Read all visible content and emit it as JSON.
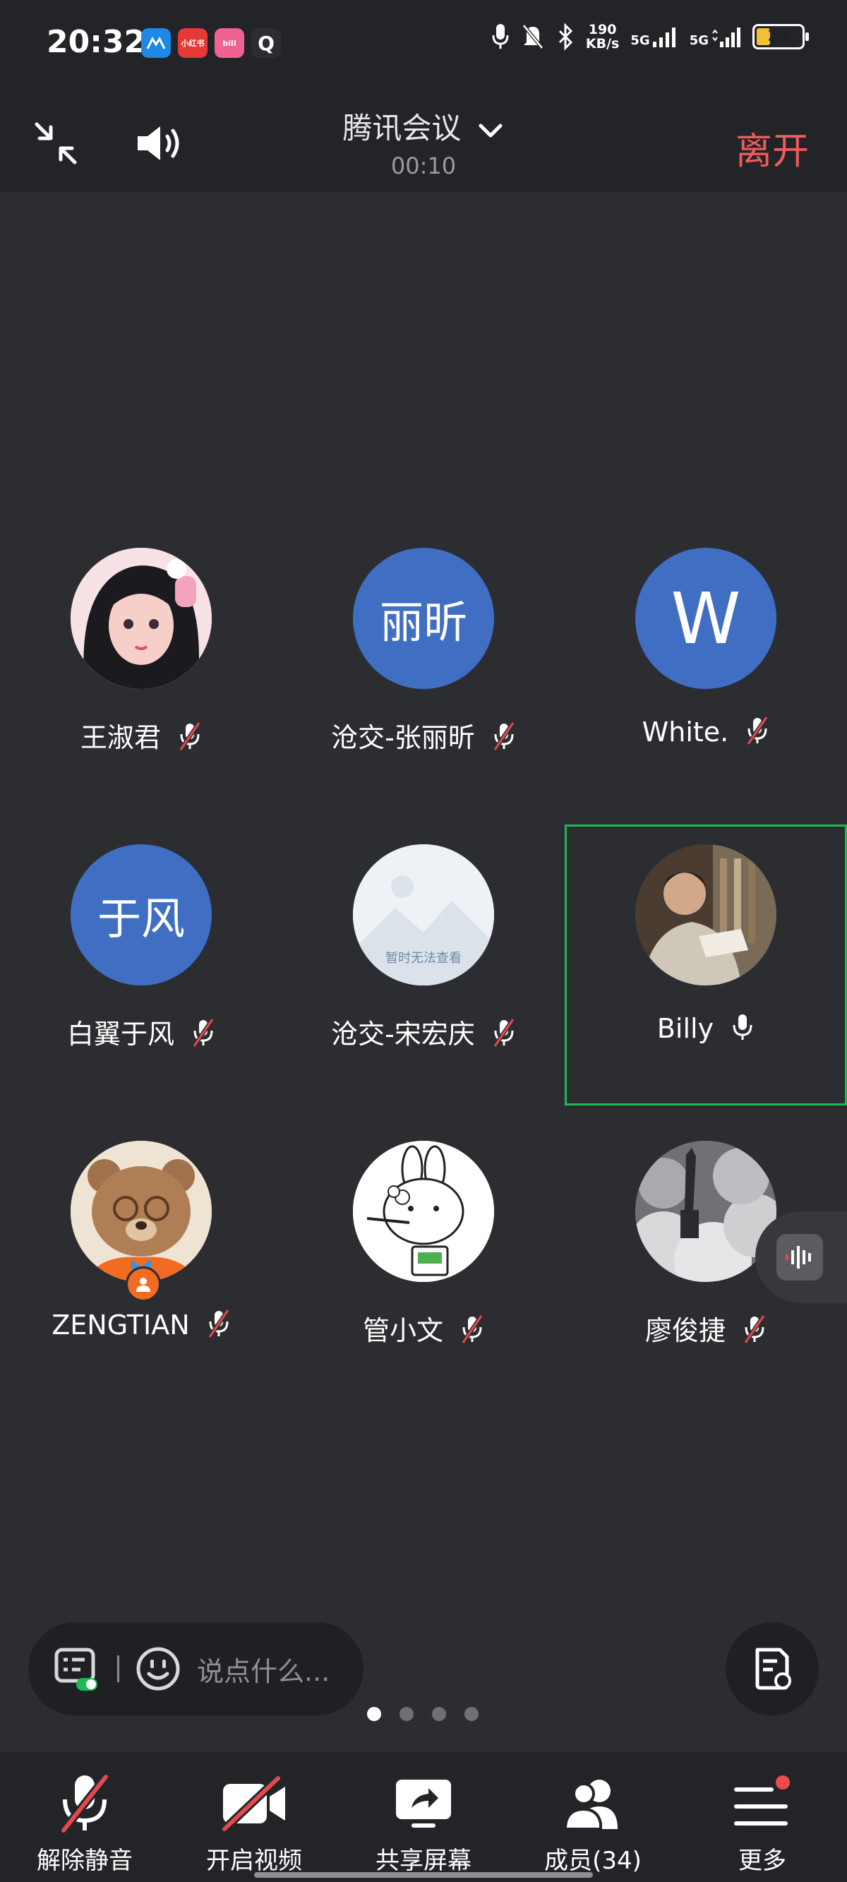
{
  "status_bar": {
    "time": "20:32",
    "app_badges": [
      {
        "name": "app-icon-blue",
        "text": "",
        "color": "#1e88e5"
      },
      {
        "name": "app-icon-xiaohongshu",
        "text": "小红书",
        "color": "#e53935"
      },
      {
        "name": "app-icon-bilibili",
        "text": "bili",
        "color": "#f06292"
      },
      {
        "name": "app-icon-q",
        "text": "Q",
        "color": "#eeeeee"
      }
    ],
    "net_speed_value": "190",
    "net_speed_unit": "KB/s",
    "signal1": "5G",
    "signal2": "5G",
    "battery": "25"
  },
  "header": {
    "title": "腾讯会议",
    "timer": "00:10",
    "leave_label": "离开"
  },
  "participants": [
    {
      "name": "王淑君",
      "avatar_type": "photo",
      "avatar_text": "",
      "mic": "muted",
      "active": false,
      "host": false
    },
    {
      "name": "沧交-张丽昕",
      "avatar_type": "initials",
      "avatar_text": "丽昕",
      "mic": "muted",
      "active": false,
      "host": false
    },
    {
      "name": "White.",
      "avatar_type": "initials",
      "avatar_text": "W",
      "mic": "muted",
      "active": false,
      "host": false
    },
    {
      "name": "白翼于风",
      "avatar_type": "initials",
      "avatar_text": "于风",
      "mic": "muted",
      "active": false,
      "host": false
    },
    {
      "name": "沧交-宋宏庆",
      "avatar_type": "placeholder",
      "avatar_text": "暂时无法查看",
      "mic": "muted",
      "active": false,
      "host": false
    },
    {
      "name": "Billy",
      "avatar_type": "photo",
      "avatar_text": "",
      "mic": "on",
      "active": true,
      "host": false
    },
    {
      "name": "ZENGTIAN",
      "avatar_type": "photo",
      "avatar_text": "",
      "mic": "muted",
      "active": false,
      "host": true
    },
    {
      "name": "管小文",
      "avatar_type": "photo",
      "avatar_text": "",
      "mic": "muted",
      "active": false,
      "host": false
    },
    {
      "name": "廖俊捷",
      "avatar_type": "photo",
      "avatar_text": "",
      "mic": "muted",
      "active": false,
      "host": false
    }
  ],
  "chat": {
    "placeholder": "说点什么..."
  },
  "pagination": {
    "total": 4,
    "current": 1
  },
  "toolbar": {
    "unmute": "解除静音",
    "video": "开启视频",
    "share": "共享屏幕",
    "members": "成员(34)",
    "more": "更多"
  },
  "colors": {
    "accent_red": "#f05b5b",
    "active_border": "#1db954",
    "avatar_blue": "#3f6ec2",
    "background": "#2b2d31"
  }
}
